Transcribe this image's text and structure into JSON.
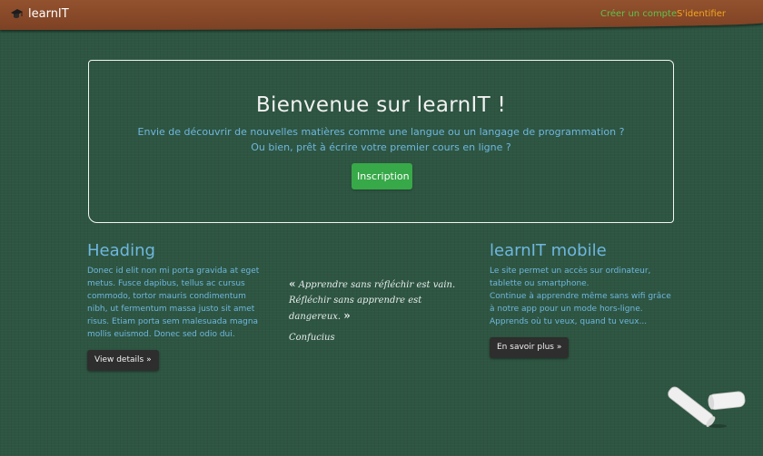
{
  "navbar": {
    "brand": "learnIT",
    "brand_icon": "graduation-cap-icon",
    "signup_link": "Créer un compte",
    "login_link": "S'identifier",
    "colors": {
      "bar": "#8b4a29",
      "signup": "#5fc24b",
      "login": "#f2a51f"
    }
  },
  "hero": {
    "title": "Bienvenue sur learnIT !",
    "line1": "Envie de découvrir de nouvelles matières comme une langue ou un langage de programmation ?",
    "line2": "Ou bien, prêt à écrire votre premier cours en ligne ?",
    "button": "Inscription"
  },
  "left_col": {
    "heading": "Heading",
    "text": "Donec id elit non mi porta gravida at eget metus. Fusce dapibus, tellus ac cursus commodo, tortor mauris condimentum nibh, ut fermentum massa justo sit amet risus. Etiam porta sem malesuada magna mollis euismod. Donec sed odio dui.",
    "button": "View details »"
  },
  "quote": {
    "open_mark": "«",
    "line1": "Apprendre sans réfléchir est vain.",
    "line2": "Réfléchir sans apprendre est dangereux.",
    "close_mark": "»",
    "author": "Confucius"
  },
  "right_col": {
    "heading": "learnIT mobile",
    "line1": "Le site permet un accès sur ordinateur, tablette ou smartphone.",
    "line2": "Continue à apprendre même sans wifi grâce à notre app pour un mode hors-ligne.",
    "line3": "Apprends où tu veux, quand tu veux...",
    "button": "En savoir plus »"
  },
  "decor": {
    "chalk_icon": "chalk-pieces-icon",
    "background": "#2d5541"
  }
}
